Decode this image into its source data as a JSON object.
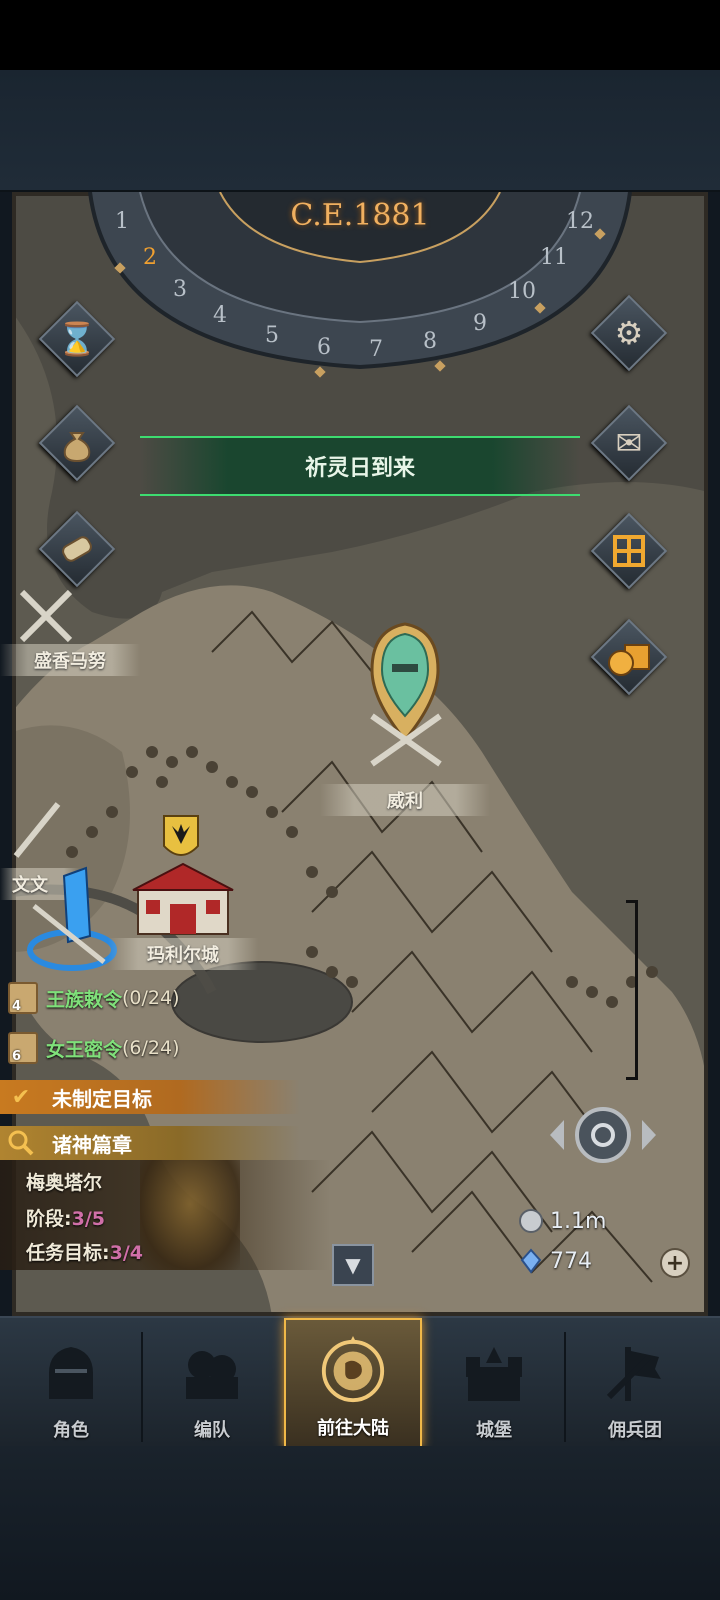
{
  "header": {
    "era": "C.E.1881"
  },
  "month_dial": {
    "months": [
      "1",
      "2",
      "3",
      "4",
      "5",
      "6",
      "7",
      "8",
      "9",
      "10",
      "11",
      "12"
    ],
    "current_month": "2"
  },
  "event_banner": {
    "text": "祈灵日到来"
  },
  "map_labels": {
    "city_1": "盛香马努",
    "city_2": "威利",
    "city_3": "文文",
    "capital": "玛利尔城"
  },
  "quests": [
    {
      "num": "4",
      "label": "王族敕令",
      "count": "(0/24)"
    },
    {
      "num": "6",
      "label": "女王密令",
      "count": "(6/24)"
    }
  ],
  "goals": {
    "unset": "未制定目标",
    "chapter": "诸神篇章"
  },
  "chapter_panel": {
    "boss_name": "梅奥塔尔",
    "stage_label": "阶段:",
    "stage_value": "3/5",
    "task_label": "任务目标:",
    "task_value": "3/4"
  },
  "resources": {
    "silver": "1.1m",
    "crystal": "774"
  },
  "nav": [
    {
      "label": "角色",
      "icon": "knight-helmet-icon"
    },
    {
      "label": "编队",
      "icon": "squad-icon"
    },
    {
      "label": "前往大陆",
      "icon": "compass-globe-icon",
      "active": true
    },
    {
      "label": "城堡",
      "icon": "castle-icon"
    },
    {
      "label": "佣兵团",
      "icon": "mercenary-banner-icon"
    }
  ],
  "colors": {
    "accent_gold": "#f0b848",
    "event_green": "#3ddc70",
    "quest_green": "#7fe07a",
    "progress_pink": "#d06fa8"
  }
}
